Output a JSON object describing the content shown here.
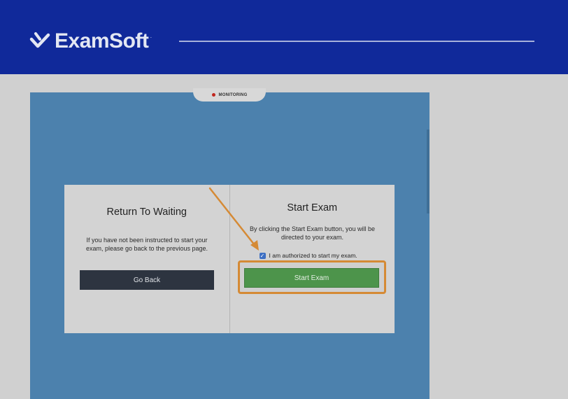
{
  "header": {
    "logo_text": "ExamSoft",
    "logo_mark": "·",
    "brand_color": "#10299a"
  },
  "monitor": {
    "label": "MONITORING",
    "dot_color": "#c0261e"
  },
  "return_panel": {
    "title": "Return To Waiting",
    "text": "If you have not been instructed to start your exam, please go back to the previous page.",
    "button_label": "Go Back"
  },
  "start_panel": {
    "title": "Start Exam",
    "text": "By clicking the Start Exam button, you will be directed to your exam.",
    "checkbox_label": "I am authorized to start my exam.",
    "checkbox_checked": true,
    "button_label": "Start Exam"
  },
  "annotation": {
    "arrow_color": "#d58a35",
    "highlight_color": "#d58a35"
  }
}
